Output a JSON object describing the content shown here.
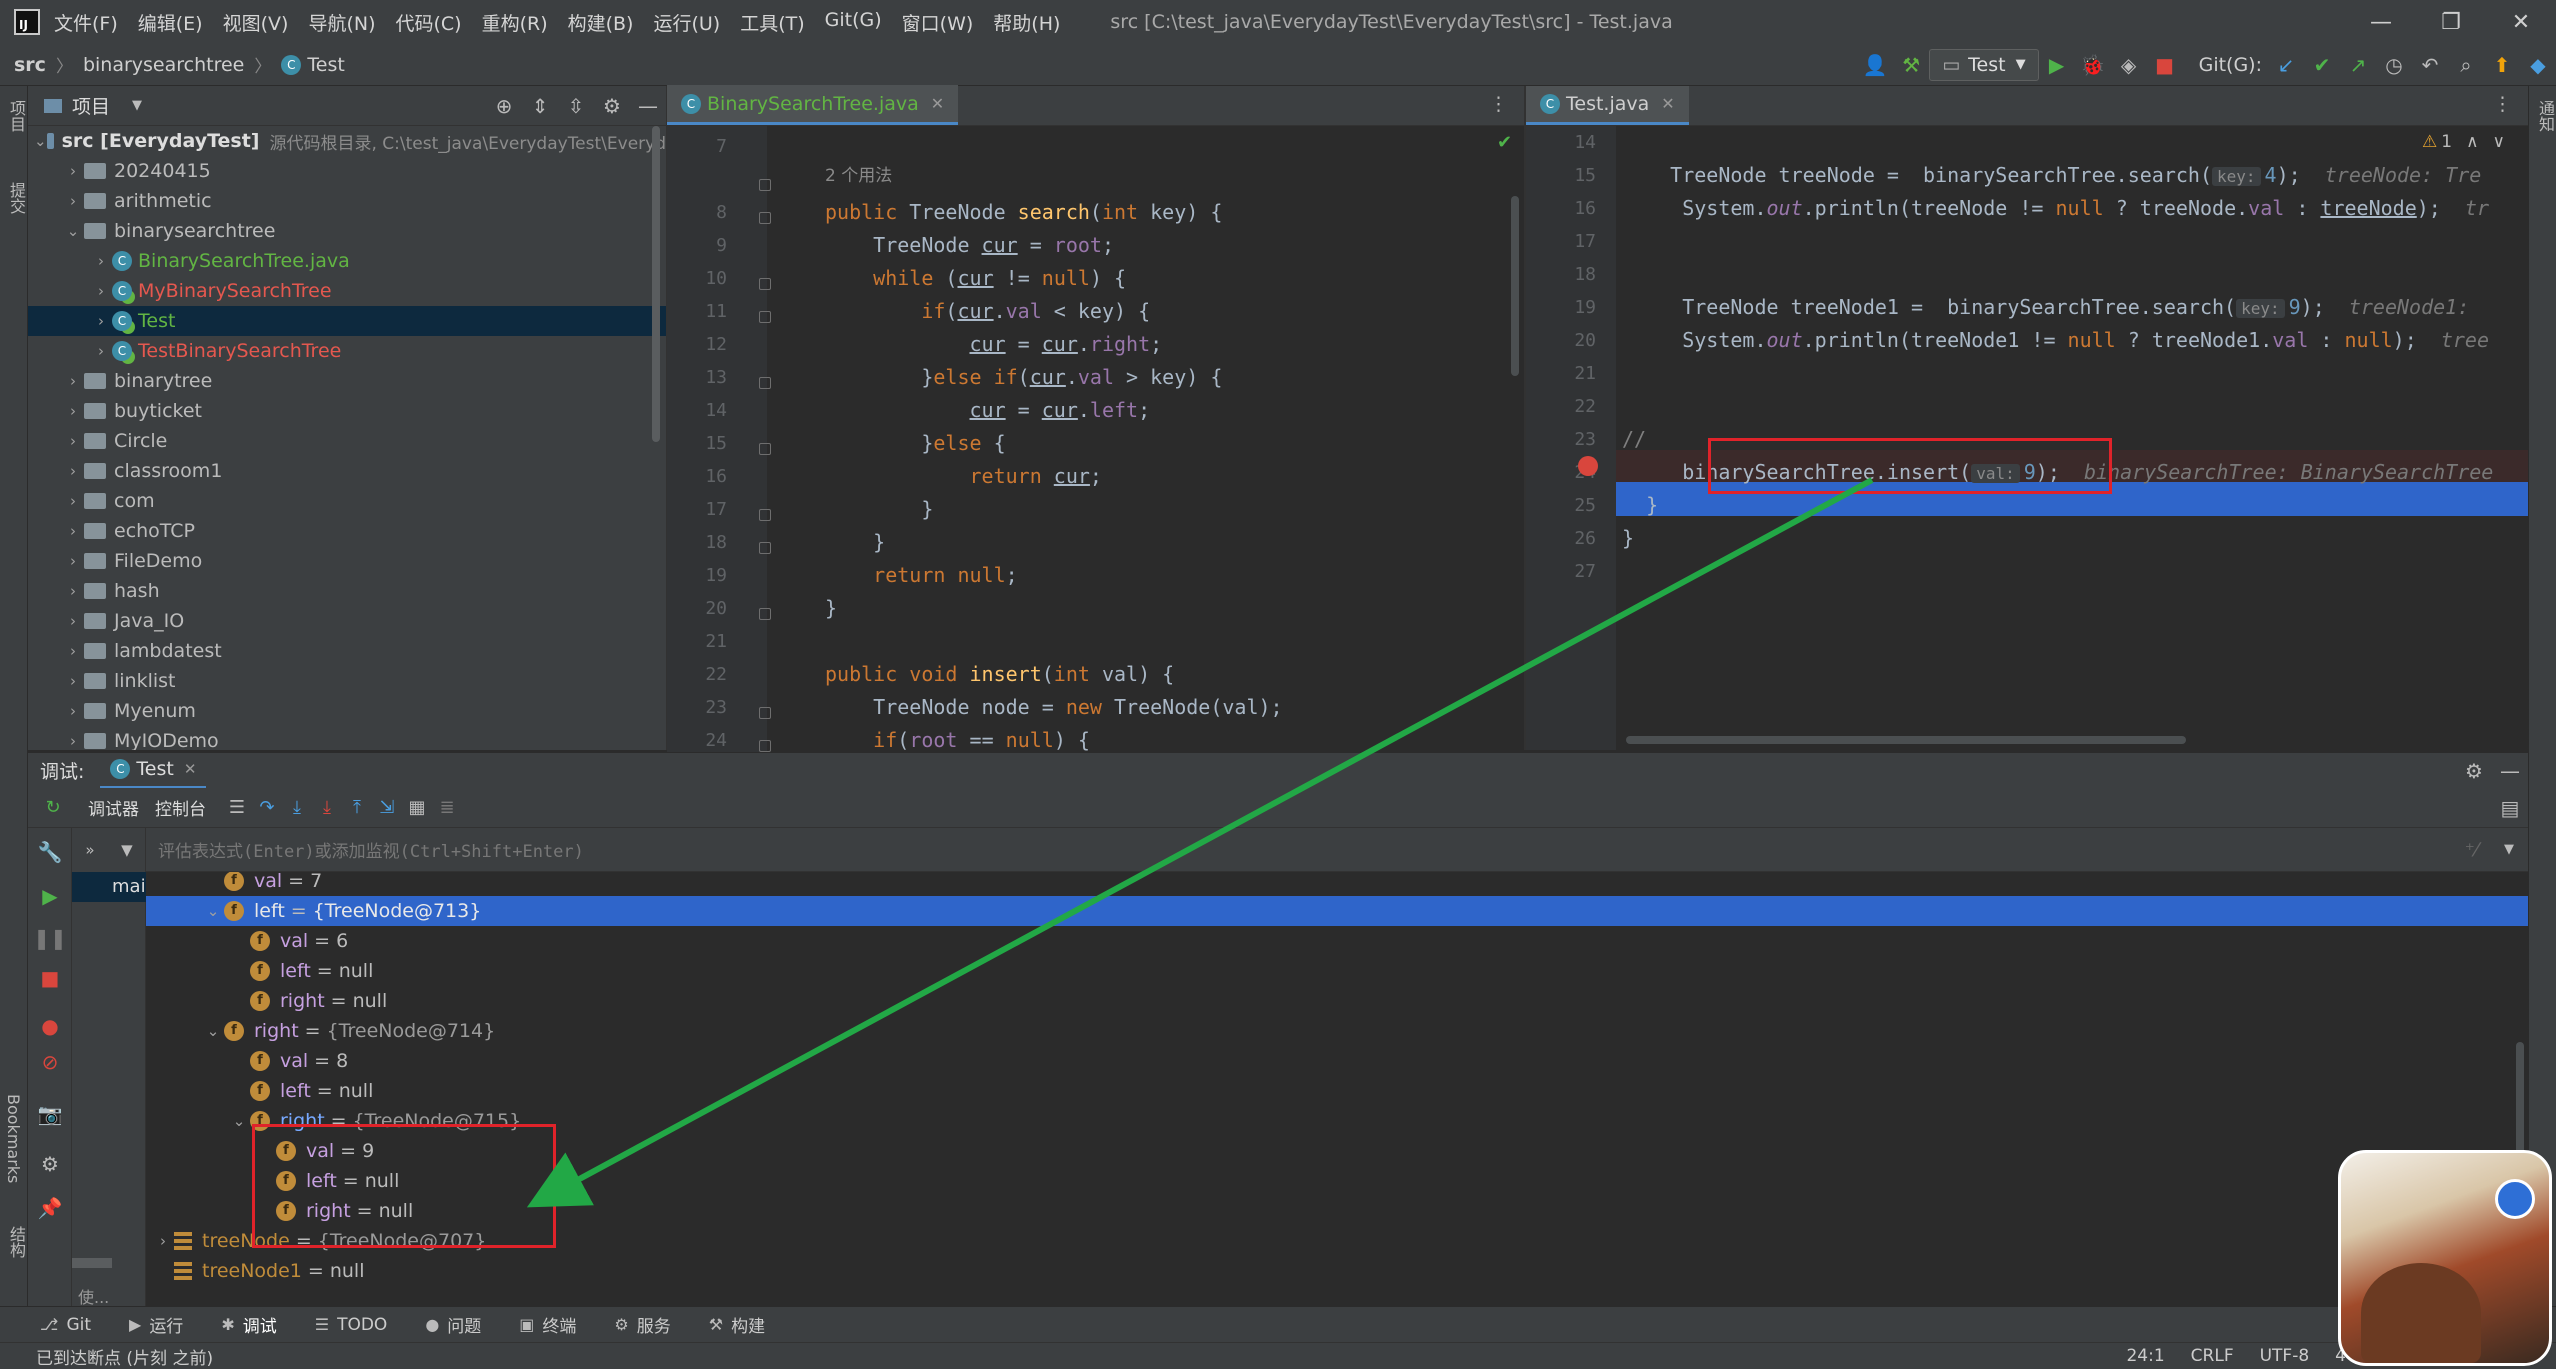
{
  "window": {
    "menu": [
      "文件(F)",
      "编辑(E)",
      "视图(V)",
      "导航(N)",
      "代码(C)",
      "重构(R)",
      "构建(B)",
      "运行(U)",
      "工具(T)",
      "Git(G)",
      "窗口(W)",
      "帮助(H)"
    ],
    "title": "src [C:\\test_java\\EverydayTest\\EverydayTest\\src] - Test.java"
  },
  "navbar": {
    "crumbs": [
      "src",
      "binarysearchtree",
      "Test"
    ],
    "run_config": "Test",
    "git_label": "Git(G):"
  },
  "project": {
    "header": "项目",
    "root_name": "src [EverydayTest]",
    "root_desc": "源代码根目录,  C:\\test_java\\EverydayTest\\Everyd",
    "items": [
      {
        "label": "20240415",
        "depth": 1,
        "kind": "folder",
        "color": "#bbbbbb",
        "open": false
      },
      {
        "label": "arithmetic",
        "depth": 1,
        "kind": "folder",
        "color": "#bbbbbb",
        "open": false
      },
      {
        "label": "binarysearchtree",
        "depth": 1,
        "kind": "folder",
        "color": "#bbbbbb",
        "open": true
      },
      {
        "label": "BinarySearchTree.java",
        "depth": 2,
        "kind": "java",
        "color": "#62b543",
        "open": false
      },
      {
        "label": "MyBinarySearchTree",
        "depth": 2,
        "kind": "class",
        "color": "#e5584f",
        "open": false
      },
      {
        "label": "Test",
        "depth": 2,
        "kind": "class",
        "color": "#62b543",
        "open": false,
        "selected": true
      },
      {
        "label": "TestBinarySearchTree",
        "depth": 2,
        "kind": "class",
        "color": "#e5584f",
        "open": false
      },
      {
        "label": "binarytree",
        "depth": 1,
        "kind": "folder",
        "color": "#bbbbbb",
        "open": false
      },
      {
        "label": "buyticket",
        "depth": 1,
        "kind": "folder",
        "color": "#bbbbbb",
        "open": false
      },
      {
        "label": "Circle",
        "depth": 1,
        "kind": "folder",
        "color": "#bbbbbb",
        "open": false
      },
      {
        "label": "classroom1",
        "depth": 1,
        "kind": "folder",
        "color": "#bbbbbb",
        "open": false
      },
      {
        "label": "com",
        "depth": 1,
        "kind": "folder",
        "color": "#bbbbbb",
        "open": false
      },
      {
        "label": "echoTCP",
        "depth": 1,
        "kind": "folder",
        "color": "#bbbbbb",
        "open": false
      },
      {
        "label": "FileDemo",
        "depth": 1,
        "kind": "folder",
        "color": "#bbbbbb",
        "open": false
      },
      {
        "label": "hash",
        "depth": 1,
        "kind": "folder",
        "color": "#bbbbbb",
        "open": false
      },
      {
        "label": "Java_IO",
        "depth": 1,
        "kind": "folder",
        "color": "#bbbbbb",
        "open": false
      },
      {
        "label": "lambdatest",
        "depth": 1,
        "kind": "folder",
        "color": "#bbbbbb",
        "open": false
      },
      {
        "label": "linklist",
        "depth": 1,
        "kind": "folder",
        "color": "#bbbbbb",
        "open": false
      },
      {
        "label": "Myenum",
        "depth": 1,
        "kind": "folder",
        "color": "#bbbbbb",
        "open": false
      },
      {
        "label": "MyIODemo",
        "depth": 1,
        "kind": "folder",
        "color": "#bbbbbb",
        "open": false
      }
    ]
  },
  "editor_left": {
    "tab": "BinarySearchTree.java",
    "usages": "2 个用法",
    "lines": [
      {
        "n": "7",
        "code": ""
      },
      {
        "n": "8",
        "code": "<span class='kw'>public</span> TreeNode <span class='fn'>search</span>(<span class='kw'>int</span> key) {"
      },
      {
        "n": "9",
        "code": "    TreeNode <span class='ul'>cur</span> = <span class='fld'>root</span>;"
      },
      {
        "n": "10",
        "code": "    <span class='kw'>while</span> (<span class='ul'>cur</span> != <span class='kw'>null</span>) {"
      },
      {
        "n": "11",
        "code": "        <span class='kw'>if</span>(<span class='ul'>cur</span>.<span class='fld'>val</span> &lt; key) {"
      },
      {
        "n": "12",
        "code": "            <span class='ul'>cur</span> = <span class='ul'>cur</span>.<span class='fld'>right</span>;"
      },
      {
        "n": "13",
        "code": "        }<span class='kw'>else if</span>(<span class='ul'>cur</span>.<span class='fld'>val</span> &gt; key) {"
      },
      {
        "n": "14",
        "code": "            <span class='ul'>cur</span> = <span class='ul'>cur</span>.<span class='fld'>left</span>;"
      },
      {
        "n": "15",
        "code": "        }<span class='kw'>else</span> {"
      },
      {
        "n": "16",
        "code": "            <span class='kw'>return</span> <span class='ul'>cur</span>;"
      },
      {
        "n": "17",
        "code": "        }"
      },
      {
        "n": "18",
        "code": "    }"
      },
      {
        "n": "19",
        "code": "    <span class='kw'>return null</span>;"
      },
      {
        "n": "20",
        "code": "}"
      },
      {
        "n": "21",
        "code": ""
      },
      {
        "n": "22",
        "code": "<span class='kw'>public void</span> <span class='fn'>insert</span>(<span class='kw'>int</span> val) {"
      },
      {
        "n": "23",
        "code": "    TreeNode node = <span class='kw'>new</span> TreeNode(val);"
      },
      {
        "n": "24",
        "code": "    <span class='kw'>if</span>(<span class='fld'>root</span> == <span class='kw'>null</span>) {"
      }
    ]
  },
  "editor_right": {
    "tab": "Test.java",
    "warning_count": "1",
    "lines": [
      {
        "n": "14",
        "code": ""
      },
      {
        "n": "15",
        "code": "    TreeNode treeNode =  binarySearchTree.search(<span class='hint'>key:</span><span class='num'>4</span>);  <span class='ghost'>treeNode: Tre</span>"
      },
      {
        "n": "16",
        "code": "     System.<span class='fld it'>out</span>.println(treeNode != <span class='kw'>null</span> ? treeNode.<span class='fld'>val</span> : <span class='ul'>treeNode</span>);  <span class='ghost'>tr</span>"
      },
      {
        "n": "17",
        "code": ""
      },
      {
        "n": "18",
        "code": ""
      },
      {
        "n": "19",
        "code": "     TreeNode treeNode1 =  binarySearchTree.search(<span class='hint'>key:</span><span class='num'>9</span>);  <span class='ghost'>treeNode1: </span>"
      },
      {
        "n": "20",
        "code": "     System.<span class='fld it'>out</span>.println(treeNode1 != <span class='kw'>null</span> ? treeNode1.<span class='fld'>val</span> : <span class='kw'>null</span>);  <span class='ghost'>tree</span>"
      },
      {
        "n": "21",
        "code": ""
      },
      {
        "n": "22",
        "code": ""
      },
      {
        "n": "23",
        "code": "<span class='cm'>//</span>"
      },
      {
        "n": "24",
        "code": "     binarySearchTree.insert(<span class='hint'>val:</span><span class='num'>9</span>);  <span class='ghost'>binarySearchTree: BinarySearchTree</span>"
      },
      {
        "n": "25",
        "code": "  }"
      },
      {
        "n": "26",
        "code": "}"
      },
      {
        "n": "27",
        "code": ""
      }
    ]
  },
  "debug": {
    "label": "调试:",
    "session_tab": "Test",
    "tab_debugger": "调试器",
    "tab_console": "控制台",
    "eval_placeholder": "评估表达式(Enter)或添加监视(Ctrl+Shift+Enter)",
    "frame": "mai",
    "frame_bottom": "使...",
    "vars": [
      {
        "d": 1,
        "t": "f",
        "name": "val",
        "eq": "= ",
        "val": "7",
        "arrow": ""
      },
      {
        "d": 1,
        "t": "f",
        "name": "left",
        "eq": "= ",
        "val": "{TreeNode@713}",
        "arrow": "v",
        "sel": true,
        "ref": true
      },
      {
        "d": 2,
        "t": "f",
        "name": "val",
        "eq": "= ",
        "val": "6",
        "arrow": ""
      },
      {
        "d": 2,
        "t": "f",
        "name": "left",
        "eq": "= ",
        "val": "null",
        "arrow": ""
      },
      {
        "d": 2,
        "t": "f",
        "name": "right",
        "eq": "= ",
        "val": "null",
        "arrow": ""
      },
      {
        "d": 1,
        "t": "f",
        "name": "right",
        "eq": "= ",
        "val": "{TreeNode@714}",
        "arrow": "v",
        "ref": true
      },
      {
        "d": 2,
        "t": "f",
        "name": "val",
        "eq": "= ",
        "val": "8",
        "arrow": ""
      },
      {
        "d": 2,
        "t": "f",
        "name": "left",
        "eq": "= ",
        "val": "null",
        "arrow": ""
      },
      {
        "d": 2,
        "t": "f",
        "name": "right",
        "eq": "= ",
        "val": "{TreeNode@715}",
        "arrow": "v",
        "ref": true,
        "blue": true
      },
      {
        "d": 3,
        "t": "f",
        "name": "val",
        "eq": "= ",
        "val": "9",
        "arrow": ""
      },
      {
        "d": 3,
        "t": "f",
        "name": "left",
        "eq": "= ",
        "val": "null",
        "arrow": ""
      },
      {
        "d": 3,
        "t": "f",
        "name": "right",
        "eq": "= ",
        "val": "null",
        "arrow": ""
      },
      {
        "d": 0,
        "t": "l",
        "name": "treeNode",
        "eq": "= ",
        "val": "{TreeNode@707}",
        "arrow": ">",
        "ref": true
      },
      {
        "d": 0,
        "t": "l",
        "name": "treeNode1",
        "eq": "= ",
        "val": "null",
        "arrow": ""
      }
    ]
  },
  "left_strip": {
    "project": "项目",
    "commit": "提交",
    "bookmarks": "Bookmarks",
    "structure": "结构"
  },
  "right_strip": {
    "notify": "通知"
  },
  "bottom_tabs": [
    {
      "icon": "⎇",
      "label": "Git"
    },
    {
      "icon": "▶",
      "label": "运行"
    },
    {
      "icon": "✱",
      "label": "调试",
      "active": true
    },
    {
      "icon": "☰",
      "label": "TODO"
    },
    {
      "icon": "●",
      "label": "问题"
    },
    {
      "icon": "▣",
      "label": "终端"
    },
    {
      "icon": "⚙",
      "label": "服务"
    },
    {
      "icon": "⚒",
      "label": "构建"
    }
  ],
  "status": {
    "message": "已到达断点 (片刻 之前)",
    "position": "24:1",
    "line_sep": "CRLF",
    "encoding": "UTF-8",
    "indent": "4"
  },
  "colors": {
    "accent": "#4a88c7",
    "selection": "#2f65ca",
    "annotation": "#e0232a",
    "arrow": "#22a846"
  }
}
